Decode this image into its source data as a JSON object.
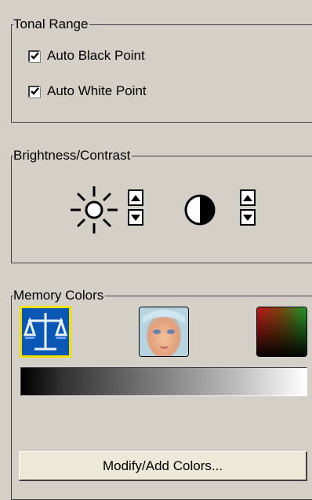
{
  "tonal_range": {
    "title": "Tonal Range",
    "auto_black_point": {
      "label": "Auto Black Point",
      "checked": true
    },
    "auto_white_point": {
      "label": "Auto White Point",
      "checked": true
    }
  },
  "brightness_contrast": {
    "title": "Brightness/Contrast",
    "brightness_icon": "sun-icon",
    "contrast_icon": "contrast-icon"
  },
  "memory_colors": {
    "title": "Memory Colors",
    "icons": [
      "balance-scale-icon",
      "skin-tone-face-icon",
      "color-spectrum-icon"
    ],
    "selected_icon": "balance-scale-icon",
    "gradient_colors": [
      "#000000",
      "#ffffff"
    ]
  },
  "modify_button": {
    "label": "Modify/Add Colors..."
  }
}
